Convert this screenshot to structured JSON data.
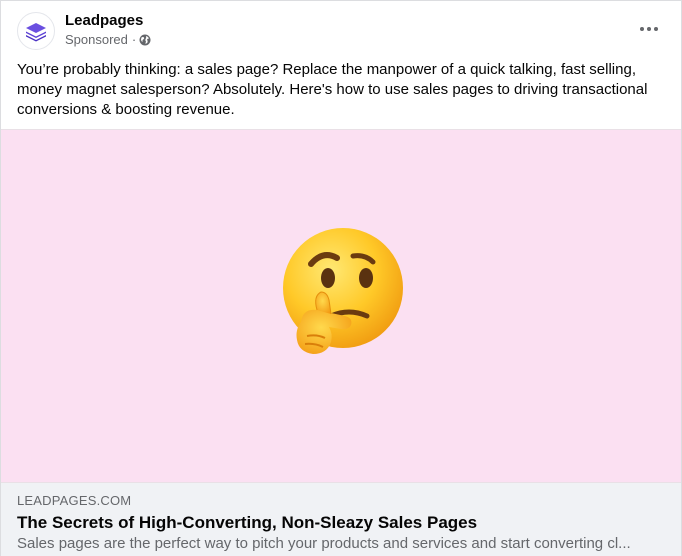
{
  "post": {
    "page_name": "Leadpages",
    "sponsored_label": "Sponsored",
    "separator": "·",
    "audience_icon": "globe-icon",
    "more_icon": "more-horizontal-icon",
    "text_lines": [
      "You’re probably thinking: a sales page? Replace the manpower of a quick talking, fast selling,",
      "money magnet salesperson? Absolutely. Here's how to use sales pages to driving transactional",
      "conversions & boosting revenue."
    ]
  },
  "media": {
    "background_color": "#fbe0f2",
    "emoji": "thinking-face-emoji"
  },
  "link": {
    "domain": "LEADPAGES.COM",
    "title": "The Secrets of High-Converting, Non-Sleazy Sales Pages",
    "description": "Sales pages are the perfect way to pitch your products and services and start converting cl..."
  },
  "colors": {
    "brand": "#5b3fd6",
    "secondary_text": "#65676b",
    "link_area_bg": "#f0f2f5"
  }
}
